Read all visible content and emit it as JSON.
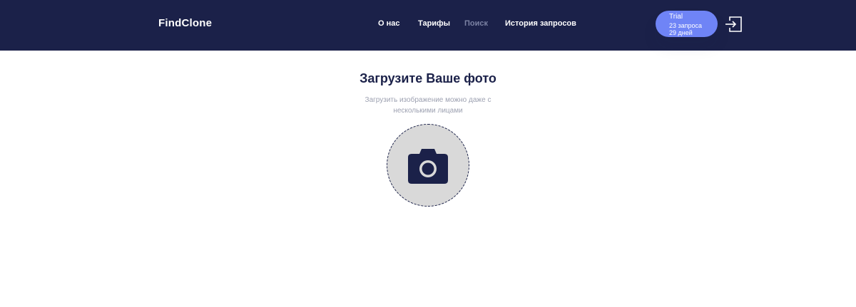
{
  "header": {
    "logo": "FindClone",
    "nav": [
      {
        "label": "О нас",
        "active": false
      },
      {
        "label": "Тарифы",
        "active": false
      },
      {
        "label": "Поиск",
        "active": true
      },
      {
        "label": "История запросов",
        "active": false
      }
    ],
    "trial": {
      "plan": "Trial",
      "requests": "23 запроса",
      "days": "29 дней"
    },
    "login_icon": "login-icon"
  },
  "main": {
    "title": "Загрузите Ваше фото",
    "subtitle_line1": "Загрузить изображение можно даже с",
    "subtitle_line2": "несколькими лицами",
    "upload_icon": "camera-icon"
  },
  "colors": {
    "header_bg": "#1b2149",
    "trial_bg": "#6f84f6",
    "upload_bg": "#d9d9d9"
  }
}
